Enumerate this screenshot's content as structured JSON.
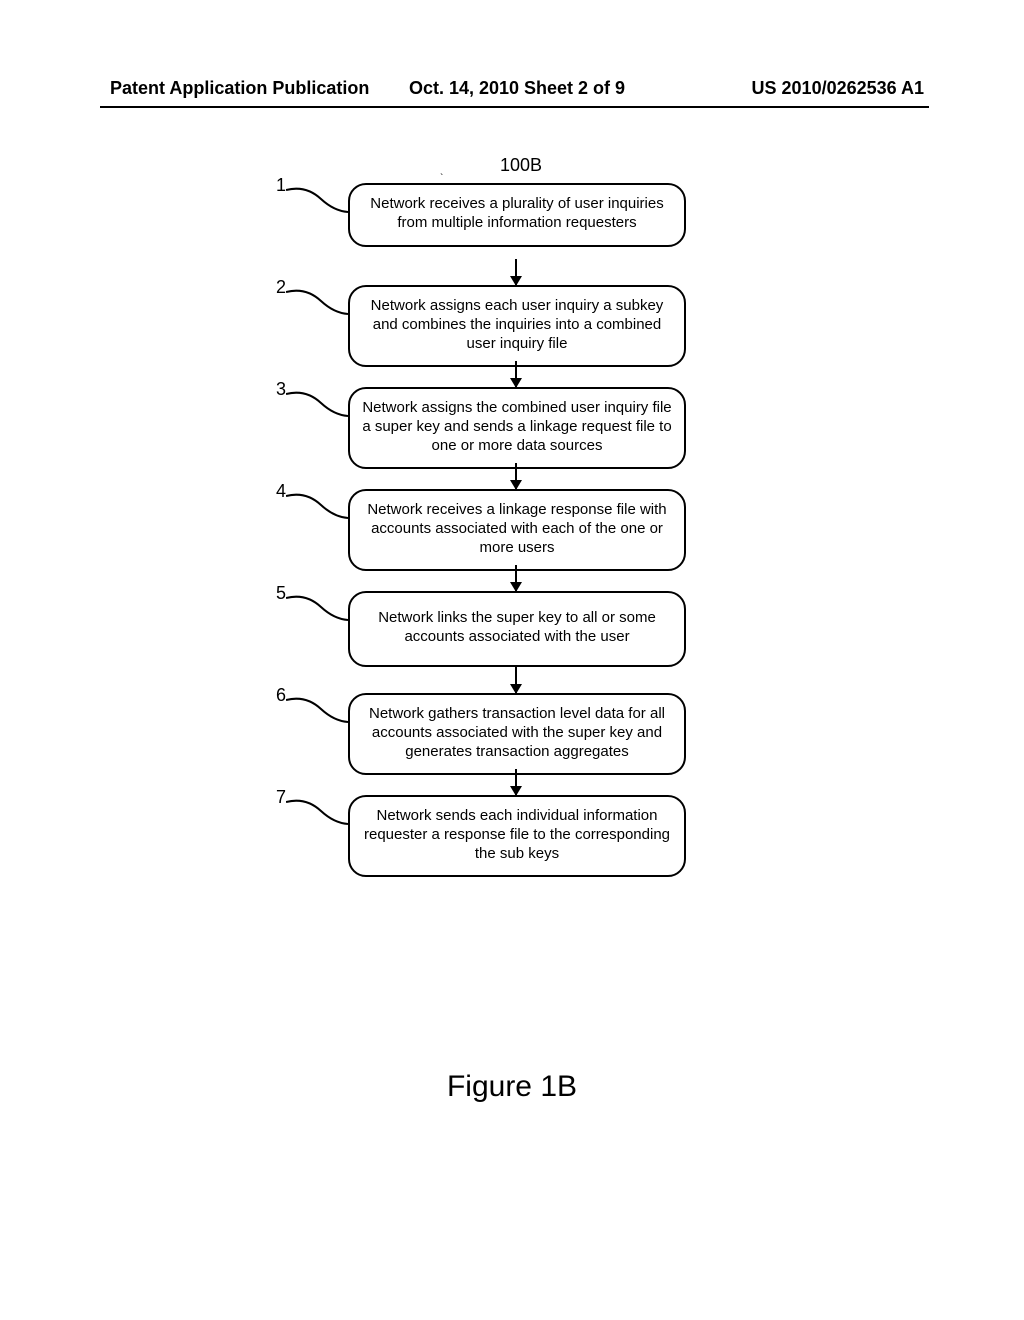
{
  "header": {
    "left": "Patent Application Publication",
    "center": "Oct. 14, 2010  Sheet 2 of 9",
    "right": "US 2010/0262536 A1"
  },
  "figure": {
    "label": "100B",
    "caption": "Figure 1B"
  },
  "steps": [
    {
      "num": "1",
      "text": "Network receives a plurality of user inquiries from multiple information requesters"
    },
    {
      "num": "2",
      "text": "Network assigns each user inquiry a subkey and combines the inquiries into a combined user inquiry file"
    },
    {
      "num": "3",
      "text": "Network assigns the combined user inquiry file a super key and sends a linkage request file to one or more data sources"
    },
    {
      "num": "4",
      "text": "Network receives a linkage response file with accounts associated with each of the one or more users"
    },
    {
      "num": "5",
      "text": "Network links the super key to all or some accounts associated with the user"
    },
    {
      "num": "6",
      "text": "Network gathers transaction level data for all accounts associated with the super key and generates transaction aggregates"
    },
    {
      "num": "7",
      "text": "Network sends each individual information requester a response file to the corresponding the sub keys"
    }
  ]
}
